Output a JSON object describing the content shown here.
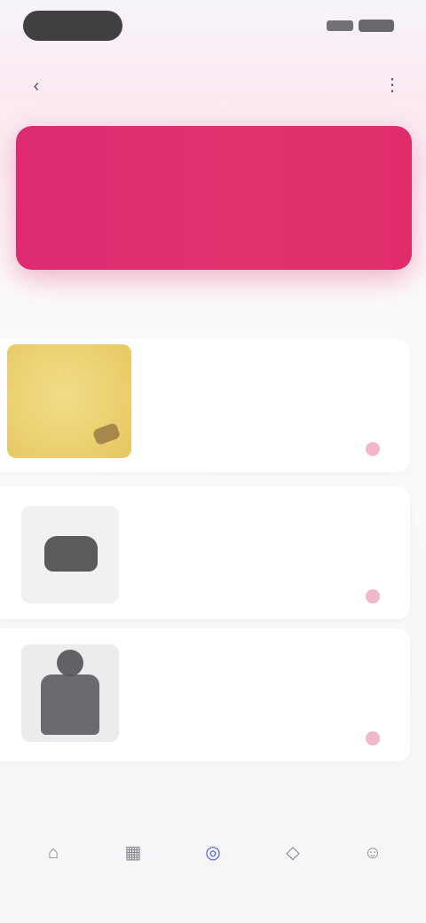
{
  "status_bar": {},
  "header": {
    "back_icon": "chevron-left-icon",
    "title": "",
    "menu_icon": "more-icon"
  },
  "banner": {
    "title": "",
    "subtitle": "",
    "color": "#e2306f"
  },
  "section": {
    "title": ""
  },
  "list": {
    "items": [
      {
        "title": "",
        "description": "",
        "action_label": "",
        "thumb_color": "#ecd173"
      },
      {
        "title": "",
        "description": "",
        "action_label": ""
      },
      {
        "title": "",
        "description": "",
        "action_label": ""
      }
    ]
  },
  "footer": {
    "left_label": "",
    "right_label": ""
  },
  "tabbar": {
    "active_color": "#4f5de0",
    "tabs": [
      {
        "label": "",
        "icon": "home-icon"
      },
      {
        "label": "",
        "icon": "grid-icon"
      },
      {
        "label": "",
        "icon": "compass-icon"
      },
      {
        "label": "",
        "icon": "bag-icon"
      },
      {
        "label": "",
        "icon": "user-icon"
      }
    ]
  }
}
